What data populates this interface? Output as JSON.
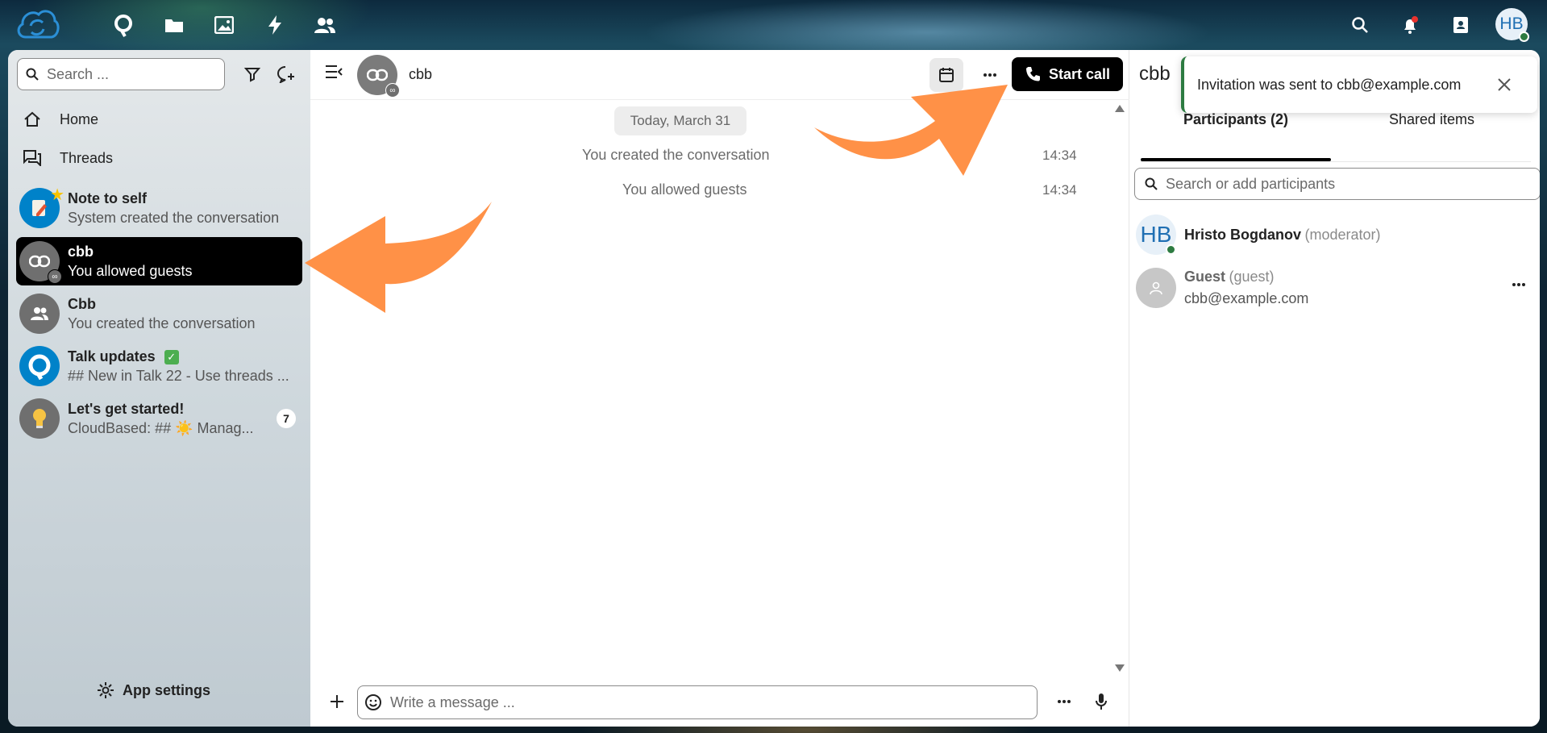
{
  "topbar": {
    "apps": [
      "talk-icon",
      "files-icon",
      "photos-icon",
      "activity-icon",
      "contacts-icon"
    ],
    "avatar_initials": "HB"
  },
  "nav": {
    "search_placeholder": "Search ...",
    "links": [
      {
        "label": "Home",
        "icon": "home-icon"
      },
      {
        "label": "Threads",
        "icon": "threads-icon"
      }
    ],
    "conversations": [
      {
        "name": "Note to self",
        "sub": "System created the conversation"
      },
      {
        "name": "cbb",
        "sub": "You allowed guests"
      },
      {
        "name": "Cbb",
        "sub": "You created the conversation"
      },
      {
        "name": "Talk updates",
        "sub": "## New in Talk 22 - Use threads ..."
      },
      {
        "name": "Let's get started!",
        "sub": "CloudBased: ## ☀️  Manag...",
        "badge": "7"
      }
    ],
    "settings_label": "App settings"
  },
  "chat": {
    "title": "cbb",
    "start_call": "Start call",
    "date": "Today, March 31",
    "messages": [
      {
        "text": "You created the conversation",
        "time": "14:34"
      },
      {
        "text": "You allowed guests",
        "time": "14:34"
      }
    ],
    "composer_placeholder": "Write a message ..."
  },
  "sidebar": {
    "title": "cbb",
    "tabs": [
      {
        "label": "Participants (2)",
        "active": true
      },
      {
        "label": "Shared items",
        "active": false
      }
    ],
    "search_placeholder": "Search or add participants",
    "participants": [
      {
        "initials": "HB",
        "name": "Hristo Bogdanov",
        "role": "(moderator)",
        "email": ""
      },
      {
        "initials": "",
        "name": "Guest",
        "role": "(guest)",
        "email": "cbb@example.com"
      }
    ]
  },
  "toast": {
    "message": "Invitation was sent to cbb@example.com"
  },
  "colors": {
    "accent": "#000000",
    "status_online": "#2d7b41",
    "annotation_arrow": "#ff9147"
  }
}
